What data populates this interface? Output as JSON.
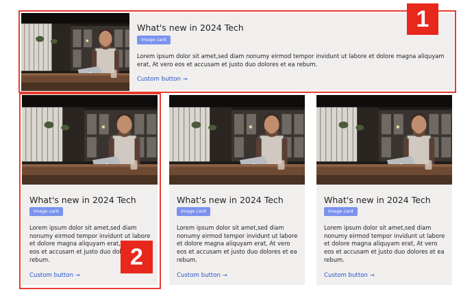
{
  "cards": [
    {
      "title": "What's new in 2024 Tech",
      "badge": "Image card",
      "body": "Lorem ipsum dolor sit amet,sed diam nonumy eirmod tempor invidunt ut labore et dolore magna aliquyam erat, At vero eos et accusam et justo duo dolores et ea rebum.",
      "button": "Custom button",
      "arrow": "→"
    },
    {
      "title": "What's new in 2024 Tech",
      "badge": "Image card",
      "body": "Lorem ipsum dolor sit amet,sed diam nonumy eirmod tempor invidunt ut labore et dolore magna aliquyam erat, At vero eos et accusam et justo duo dolores et ea rebum.",
      "button": "Custom button",
      "arrow": "→"
    },
    {
      "title": "What's new in 2024 Tech",
      "badge": "Image card",
      "body": "Lorem ipsum dolor sit amet,sed diam nonumy eirmod tempor invidunt ut labore et dolore magna aliquyam erat, At vero eos et accusam et justo duo dolores et ea rebum.",
      "button": "Custom button",
      "arrow": "→"
    },
    {
      "title": "What's new in 2024 Tech",
      "badge": "Image card",
      "body": "Lorem ipsum dolor sit amet,sed diam nonumy eirmod tempor invidunt ut labore et dolore magna aliquyam erat, At vero eos et accusam et justo duo dolores et ea rebum.",
      "button": "Custom button",
      "arrow": "→"
    }
  ],
  "annotations": [
    {
      "label": "1"
    },
    {
      "label": "2"
    }
  ],
  "colors": {
    "card_bg": "#f1efee",
    "badge_bg": "#7b93ee",
    "link": "#2454c9",
    "annotation_red": "#e8271d"
  }
}
